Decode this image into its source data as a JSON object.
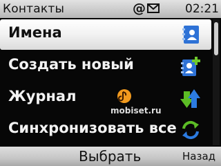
{
  "status_bar": {
    "title": "Контакты",
    "at_symbol": "@",
    "envelope_icon": "envelope-icon",
    "time": "02:21"
  },
  "menu": {
    "items": [
      {
        "label": "Имена",
        "icon": "contacts-book-icon",
        "selected": true
      },
      {
        "label": "Создать новый",
        "icon": "add-contact-icon",
        "selected": false
      },
      {
        "label": "Журнал",
        "icon": "log-arrows-icon",
        "selected": false
      },
      {
        "label": "Синхронизовать все",
        "icon": "sync-icon",
        "selected": false
      }
    ]
  },
  "watermark": {
    "text": "mobiset.ru",
    "logo": "mobiset-logo"
  },
  "softkeys": {
    "center": "Выбрать",
    "right": "Назад"
  },
  "colors": {
    "contact_icon_blue": "#2e72d6",
    "plus_green": "#6fc92c",
    "arrow_green": "#5cbc25",
    "arrow_blue": "#2c7be0"
  }
}
